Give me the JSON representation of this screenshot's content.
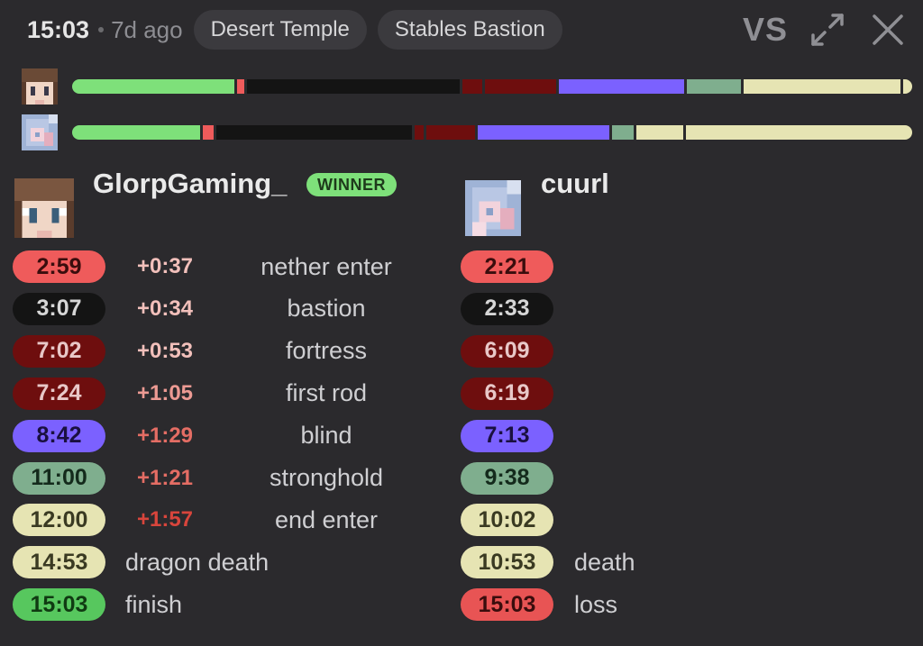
{
  "header": {
    "time": "15:03",
    "ago": "7d ago",
    "chips": [
      "Desert Temple",
      "Stables Bastion"
    ],
    "vs_label": "VS"
  },
  "colors": {
    "background": "#2b2a2d",
    "nether_enter": "#ef5b5b",
    "bastion": "#141414",
    "fortress": "#6e0e0e",
    "blind": "#7b61ff",
    "stronghold": "#7fae8e",
    "end": "#e6e4b3",
    "finish": "#57c75e",
    "loss": "#e85454",
    "timeline_start": "#7ee07a"
  },
  "players": [
    {
      "name": "GlorpGaming_",
      "badge": "WINNER",
      "avatar_icon": "pixel-avatar-brown-hair"
    },
    {
      "name": "cuurl",
      "badge": "",
      "avatar_icon": "pixel-avatar-blue-pink"
    }
  ],
  "splits": {
    "left": [
      {
        "time": "2:59",
        "diff": "+0:37",
        "label": "nether enter",
        "kind": "nether_enter"
      },
      {
        "time": "3:07",
        "diff": "+0:34",
        "label": "bastion",
        "kind": "bastion"
      },
      {
        "time": "7:02",
        "diff": "+0:53",
        "label": "fortress",
        "kind": "fortress"
      },
      {
        "time": "7:24",
        "diff": "+1:05",
        "label": "first rod",
        "kind": "fortress"
      },
      {
        "time": "8:42",
        "diff": "+1:29",
        "label": "blind",
        "kind": "blind"
      },
      {
        "time": "11:00",
        "diff": "+1:21",
        "label": "stronghold",
        "kind": "stronghold"
      },
      {
        "time": "12:00",
        "diff": "+1:57",
        "label": "end enter",
        "kind": "end"
      },
      {
        "time": "14:53",
        "diff": "",
        "label": "dragon death",
        "kind": "end"
      },
      {
        "time": "15:03",
        "diff": "",
        "label": "finish",
        "kind": "finish"
      }
    ],
    "right": [
      {
        "time": "2:21",
        "label": "",
        "kind": "nether_enter"
      },
      {
        "time": "2:33",
        "label": "",
        "kind": "bastion"
      },
      {
        "time": "6:09",
        "label": "",
        "kind": "fortress"
      },
      {
        "time": "6:19",
        "label": "",
        "kind": "fortress"
      },
      {
        "time": "7:13",
        "label": "",
        "kind": "blind"
      },
      {
        "time": "9:38",
        "label": "",
        "kind": "stronghold"
      },
      {
        "time": "10:02",
        "label": "",
        "kind": "end"
      },
      {
        "time": "10:53",
        "label": "death",
        "kind": "end"
      },
      {
        "time": "15:03",
        "label": "loss",
        "kind": "loss"
      }
    ]
  },
  "timelines": [
    {
      "total": "15:03",
      "events": [
        "2:59",
        "3:07",
        "7:02",
        "7:24",
        "8:42",
        "11:00",
        "12:00",
        "14:53"
      ]
    },
    {
      "total": "15:03",
      "events": [
        "2:21",
        "2:33",
        "6:09",
        "6:19",
        "7:13",
        "9:38",
        "10:02",
        "10:53"
      ]
    }
  ]
}
